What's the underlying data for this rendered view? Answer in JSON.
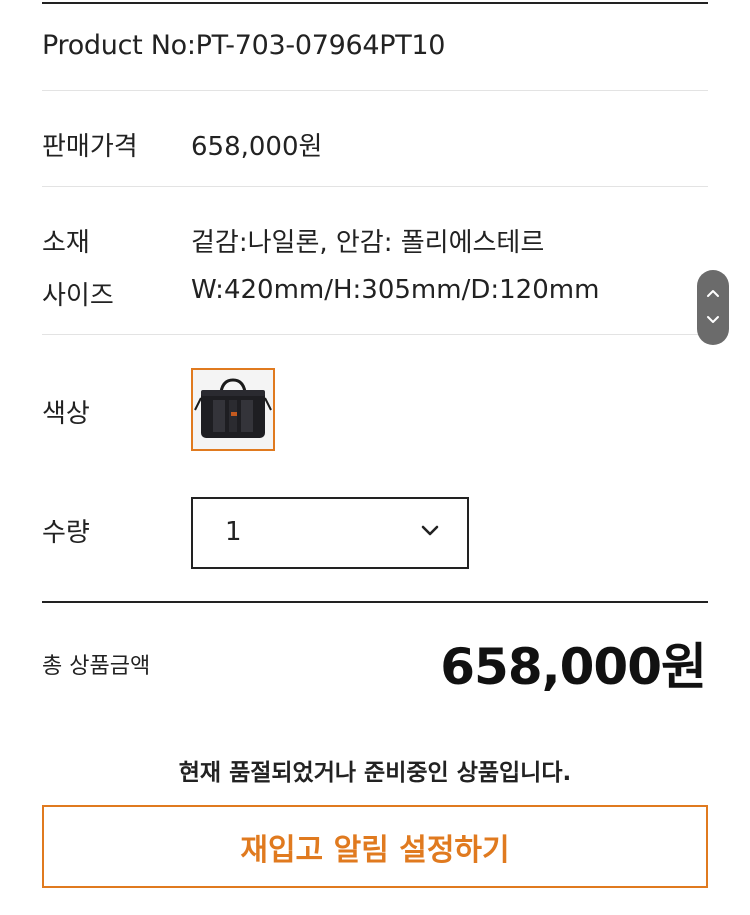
{
  "product": {
    "number_label": "Product No:PT-703-07964PT10"
  },
  "price": {
    "label": "판매가격",
    "value": "658,000원"
  },
  "material": {
    "label": "소재",
    "value": "겉감:나일론, 안감: 폴리에스테르"
  },
  "size": {
    "label": "사이즈",
    "value": "W:420mm/H:305mm/D:120mm"
  },
  "color": {
    "label": "색상",
    "swatch_icon": "black-briefcase-bag-image",
    "selected_border": "#e07a1f"
  },
  "quantity": {
    "label": "수량",
    "selected": "1",
    "icon": "chevron-down-icon"
  },
  "total": {
    "label": "총 상품금액",
    "amount": "658,000원"
  },
  "notice": "현재 품절되었거나 준비중인 상품입니다.",
  "restock_button": {
    "label": "재입고 알림 설정하기",
    "color": "#e07a1f"
  },
  "scroll_widget": {
    "up_icon": "chevron-up-icon",
    "down_icon": "chevron-down-icon"
  }
}
